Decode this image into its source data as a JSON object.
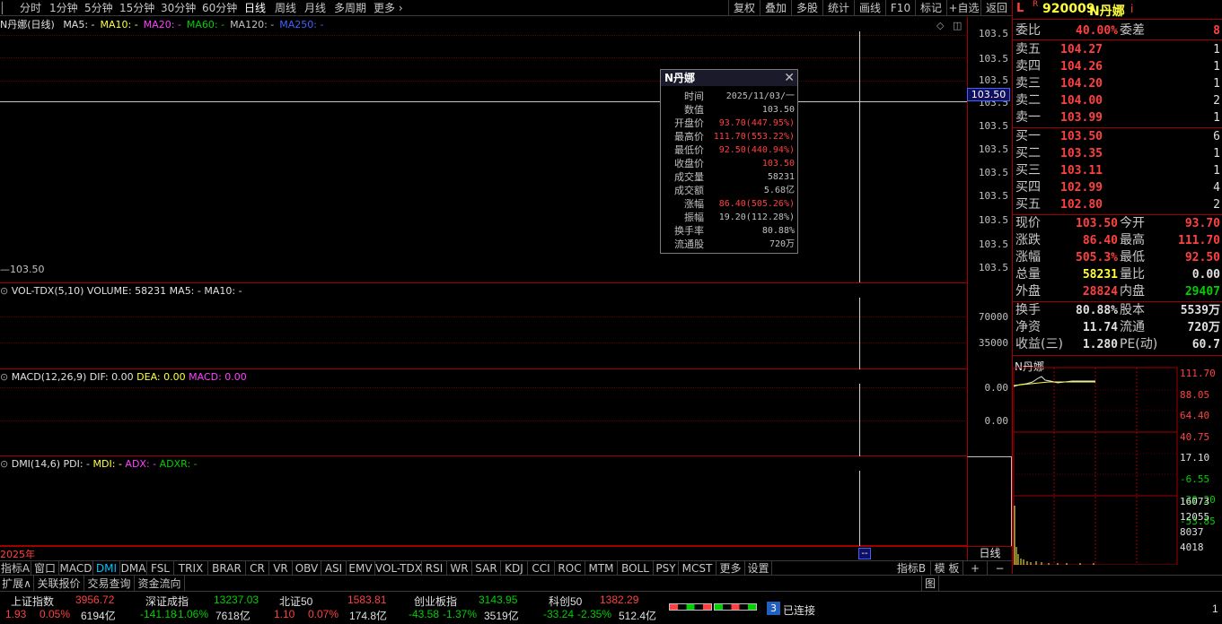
{
  "toolbar": {
    "periods": [
      "分时",
      "1分钟",
      "5分钟",
      "15分钟",
      "30分钟",
      "60分钟",
      "日线",
      "周线",
      "月线",
      "多周期",
      "更多"
    ],
    "active_period": "日线",
    "right_buttons": [
      "复权",
      "叠加",
      "多股",
      "统计",
      "画线",
      "F10",
      "标记",
      "+自选",
      "返回"
    ]
  },
  "main_chart": {
    "title": "N丹娜(日线)",
    "ma_labels": [
      {
        "text": "MA5: -",
        "color": "#e0e0e0"
      },
      {
        "text": "MA10: -",
        "color": "#ffff40"
      },
      {
        "text": "MA20: -",
        "color": "#ff40ff"
      },
      {
        "text": "MA60: -",
        "color": "#00d000"
      },
      {
        "text": "MA120: -",
        "color": "#c0c0c0"
      },
      {
        "text": "MA250: -",
        "color": "#4060ff"
      }
    ],
    "y_labels": [
      "103.5",
      "103.5",
      "103.5",
      "103.5",
      "103.5",
      "103.5",
      "103.5",
      "103.5",
      "103.5",
      "103.5",
      "103.5"
    ],
    "price_marker": "103.50",
    "low_label": "103.50",
    "year_label": "2025年",
    "cursor_label": "--"
  },
  "volume_pane": {
    "head": "VOL-TDX(5,10)",
    "volume": "VOLUME: 58231",
    "ma5": "MA5: -",
    "ma10": "MA10: -",
    "y_labels": [
      "70000",
      "35000"
    ]
  },
  "macd_pane": {
    "head": "MACD(12,26,9)",
    "dif": "DIF: 0.00",
    "dea": "DEA: 0.00",
    "macd": "MACD: 0.00",
    "y_labels": [
      "0.00",
      "0.00"
    ]
  },
  "dmi_pane": {
    "head": "DMI(14,6)",
    "pdi": "PDI: -",
    "mdi": "MDI: -",
    "adx": "ADX: -",
    "adxr": "ADXR: -"
  },
  "tooltip": {
    "title": "N丹娜",
    "rows": [
      {
        "k": "时间",
        "v": "2025/11/03/一",
        "red": false
      },
      {
        "k": "数值",
        "v": "103.50",
        "red": false
      },
      {
        "k": "开盘价",
        "v": "93.70(447.95%)",
        "red": true
      },
      {
        "k": "最高价",
        "v": "111.70(553.22%)",
        "red": true
      },
      {
        "k": "最低价",
        "v": "92.50(440.94%)",
        "red": true
      },
      {
        "k": "收盘价",
        "v": "103.50",
        "red": true
      },
      {
        "k": "成交量",
        "v": "58231",
        "red": false
      },
      {
        "k": "成交额",
        "v": "5.68亿",
        "red": false
      },
      {
        "k": "涨幅",
        "v": "86.40(505.26%)",
        "red": true
      },
      {
        "k": "振幅",
        "v": "19.20(112.28%)",
        "red": false
      },
      {
        "k": "换手率",
        "v": "80.88%",
        "red": false
      },
      {
        "k": "流通股",
        "v": "720万",
        "red": false
      }
    ]
  },
  "quote": {
    "flag_l": "L",
    "flag_r": "R",
    "code": "920009",
    "name": "N丹娜",
    "info_icon": "i",
    "weibi_label": "委比",
    "weibi": "40.00%",
    "weicha_label": "委差",
    "weicha": "8",
    "asks": [
      {
        "label": "卖五",
        "price": "104.27",
        "vol": "1"
      },
      {
        "label": "卖四",
        "price": "104.26",
        "vol": "1"
      },
      {
        "label": "卖三",
        "price": "104.20",
        "vol": "1"
      },
      {
        "label": "卖二",
        "price": "104.00",
        "vol": "2"
      },
      {
        "label": "卖一",
        "price": "103.99",
        "vol": "1"
      }
    ],
    "bids": [
      {
        "label": "买一",
        "price": "103.50",
        "vol": "6"
      },
      {
        "label": "买二",
        "price": "103.35",
        "vol": "1"
      },
      {
        "label": "买三",
        "price": "103.11",
        "vol": "1"
      },
      {
        "label": "买四",
        "price": "102.99",
        "vol": "4"
      },
      {
        "label": "买五",
        "price": "102.80",
        "vol": "2"
      }
    ],
    "stats": [
      {
        "l1": "现价",
        "v1": "103.50",
        "c1": "#ff4040",
        "l2": "今开",
        "v2": "93.70",
        "c2": "#ff4040"
      },
      {
        "l1": "涨跌",
        "v1": "86.40",
        "c1": "#ff4040",
        "l2": "最高",
        "v2": "111.70",
        "c2": "#ff4040"
      },
      {
        "l1": "涨幅",
        "v1": "505.3%",
        "c1": "#ff4040",
        "l2": "最低",
        "v2": "92.50",
        "c2": "#ff4040"
      },
      {
        "l1": "总量",
        "v1": "58231",
        "c1": "#ffff40",
        "l2": "量比",
        "v2": "0.00",
        "c2": "#e0e0e0"
      },
      {
        "l1": "外盘",
        "v1": "28824",
        "c1": "#ff4040",
        "l2": "内盘",
        "v2": "29407",
        "c2": "#00d000"
      }
    ],
    "stats2": [
      {
        "l1": "换手",
        "v1": "80.88%",
        "c1": "#e0e0e0",
        "l2": "股本",
        "v2": "5539万",
        "c2": "#e0e0e0"
      },
      {
        "l1": "净资",
        "v1": "11.74",
        "c1": "#e0e0e0",
        "l2": "流通",
        "v2": "720万",
        "c2": "#e0e0e0"
      },
      {
        "l1": "收益(三)",
        "v1": "1.280",
        "c1": "#e0e0e0",
        "l2": "PE(动)",
        "v2": "60.7",
        "c2": "#e0e0e0"
      }
    ]
  },
  "mini_chart": {
    "title": "N丹娜",
    "price_labels": [
      {
        "t": "111.70",
        "c": "#ff4040"
      },
      {
        "t": "88.05",
        "c": "#ff4040"
      },
      {
        "t": "64.40",
        "c": "#ff4040"
      },
      {
        "t": "40.75",
        "c": "#ff4040"
      },
      {
        "t": "17.10",
        "c": "#e0e0e0"
      },
      {
        "t": "-6.55",
        "c": "#00d000"
      },
      {
        "t": "-30.20",
        "c": "#00d000"
      },
      {
        "t": "-53.85",
        "c": "#00d000"
      }
    ],
    "vol_labels": [
      "16073",
      "12055",
      "8037",
      "4018"
    ],
    "side_label": "日线",
    "corner_num": "1"
  },
  "indicator_tabs": [
    "指标A",
    "窗口",
    "MACD",
    "DMI",
    "DMA",
    "FSL",
    "TRIX",
    "BRAR",
    "CR",
    "VR",
    "OBV",
    "ASI",
    "EMV",
    "VOL-TDX",
    "RSI",
    "WR",
    "SAR",
    "KDJ",
    "CCI",
    "ROC",
    "MTM",
    "BOLL",
    "PSY",
    "MCST",
    "更多",
    "设置"
  ],
  "active_tab": "DMI",
  "right_tabs": [
    "指标B",
    "模 板",
    "+",
    "−"
  ],
  "bottom_buttons": [
    "扩展∧",
    "关联报价",
    "交易查询",
    "资金流向"
  ],
  "bottom_icon_label": "图",
  "indices": [
    {
      "name": "上证指数",
      "price": "3956.72",
      "chg": "1.93",
      "pct": "0.05%",
      "amt": "6194亿",
      "up": true
    },
    {
      "name": "深证成指",
      "price": "13237.03",
      "chg": "-141.18",
      "pct": "-1.06%",
      "amt": "7618亿",
      "up": false
    },
    {
      "name": "北证50",
      "price": "1583.81",
      "chg": "1.10",
      "pct": "0.07%",
      "amt": "174.8亿",
      "up": true
    },
    {
      "name": "创业板指",
      "price": "3143.95",
      "chg": "-43.58",
      "pct": "-1.37%",
      "amt": "3519亿",
      "up": false
    },
    {
      "name": "科创50",
      "price": "1382.29",
      "chg": "-33.24",
      "pct": "-2.35%",
      "amt": "512.4亿",
      "up": false
    }
  ],
  "connection": {
    "count": "3",
    "text": "已连接"
  }
}
